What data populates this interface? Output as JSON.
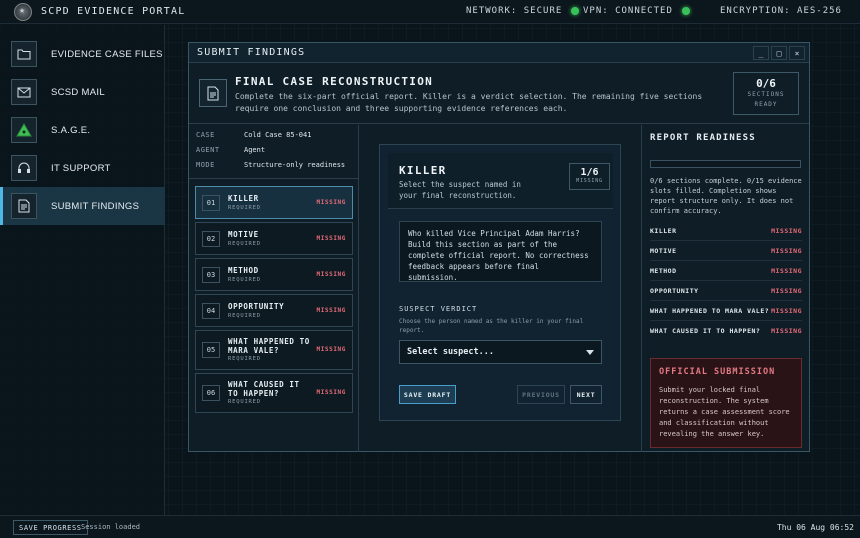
{
  "app": {
    "title": "SCPD EVIDENCE PORTAL",
    "network": "NETWORK: SECURE",
    "vpn": "VPN: CONNECTED",
    "encryption": "ENCRYPTION: AES-256",
    "status_color": "#39c25a"
  },
  "sidebar": {
    "items": [
      {
        "label": "EVIDENCE CASE FILES",
        "icon": "folder-icon"
      },
      {
        "label": "SCSD MAIL",
        "icon": "mail-icon"
      },
      {
        "label": "S.A.G.E.",
        "icon": "triangle-icon"
      },
      {
        "label": "IT SUPPORT",
        "icon": "headset-icon"
      },
      {
        "label": "SUBMIT FINDINGS",
        "icon": "document-icon",
        "active": true
      }
    ]
  },
  "window": {
    "title": "SUBMIT FINDINGS",
    "buttons": [
      "_",
      "□",
      "×"
    ]
  },
  "header": {
    "title": "FINAL CASE RECONSTRUCTION",
    "description": "Complete the six-part official report. Killer is a verdict selection. The remaining five sections require one conclusion and three supporting evidence references each.",
    "progress": "0/6",
    "progress_label1": "SECTIONS",
    "progress_label2": "READY"
  },
  "case_meta": [
    {
      "key": "CASE",
      "value": "Cold Case 85-041"
    },
    {
      "key": "AGENT",
      "value": "Agent"
    },
    {
      "key": "MODE",
      "value": "Structure-only readiness"
    }
  ],
  "sections": [
    {
      "num": "01",
      "name": "KILLER",
      "req": "REQUIRED",
      "status": "MISSING"
    },
    {
      "num": "02",
      "name": "MOTIVE",
      "req": "REQUIRED",
      "status": "MISSING"
    },
    {
      "num": "03",
      "name": "METHOD",
      "req": "REQUIRED",
      "status": "MISSING"
    },
    {
      "num": "04",
      "name": "OPPORTUNITY",
      "req": "REQUIRED",
      "status": "MISSING"
    },
    {
      "num": "05",
      "name": "WHAT HAPPENED TO MARA VALE?",
      "req": "REQUIRED",
      "status": "MISSING"
    },
    {
      "num": "06",
      "name": "WHAT CAUSED IT TO HAPPEN?",
      "req": "REQUIRED",
      "status": "MISSING"
    }
  ],
  "killer": {
    "title": "KILLER",
    "desc": "Select the suspect named in your final reconstruction.",
    "count": "1/6",
    "count_label": "MISSING",
    "question": "Who killed Vice Principal Adam Harris? Build this section as part of the complete official report. No correctness feedback appears before final submission.",
    "verdict_label": "SUSPECT VERDICT",
    "verdict_hint": "Choose the person named as the killer in your final report.",
    "select_value": "Select suspect...",
    "save": "SAVE DRAFT",
    "previous": "PREVIOUS",
    "next": "NEXT"
  },
  "readiness": {
    "title": "REPORT READINESS",
    "progress": 0,
    "text": "0/6 sections complete. 0/15 evidence slots filled. Completion shows report structure only. It does not confirm accuracy.",
    "rows": [
      {
        "name": "KILLER",
        "status": "MISSING"
      },
      {
        "name": "MOTIVE",
        "status": "MISSING"
      },
      {
        "name": "METHOD",
        "status": "MISSING"
      },
      {
        "name": "OPPORTUNITY",
        "status": "MISSING"
      },
      {
        "name": "WHAT HAPPENED TO MARA VALE?",
        "status": "MISSING"
      },
      {
        "name": "WHAT CAUSED IT TO HAPPEN?",
        "status": "MISSING"
      }
    ],
    "official_title": "OFFICIAL SUBMISSION",
    "official_desc": "Submit your locked final reconstruction. The system returns a case assessment score and classification without revealing the answer key."
  },
  "bottom": {
    "save": "SAVE PROGRESS",
    "session": "Session loaded",
    "clock": "Thu 06 Aug 06:52"
  }
}
